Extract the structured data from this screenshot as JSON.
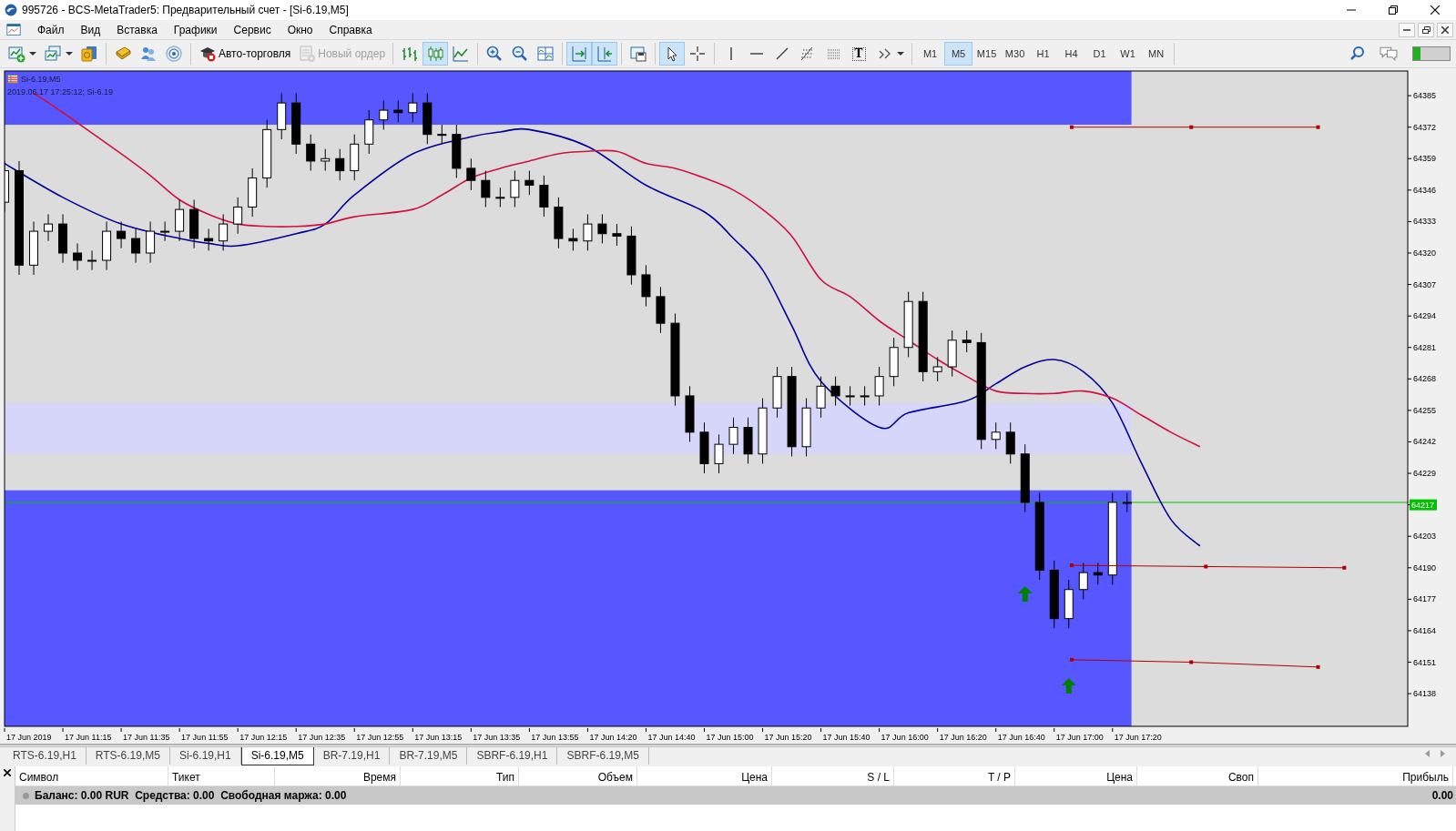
{
  "window": {
    "title": "995726 - BCS-MetaTrader5: Предварительный счет - [Si-6.19,M5]"
  },
  "menu": [
    "Файл",
    "Вид",
    "Вставка",
    "Графики",
    "Сервис",
    "Окно",
    "Справка"
  ],
  "toolbar": {
    "groups": [
      [
        {
          "kind": "icon",
          "selected": false,
          "dropdown": true
        },
        {
          "kind": "icon",
          "selected": false,
          "dropdown": true
        },
        {
          "kind": "icon",
          "selected": false
        }
      ],
      [
        {
          "kind": "icon",
          "selected": false
        },
        {
          "kind": "icon",
          "selected": false
        },
        {
          "kind": "icon",
          "selected": false
        }
      ],
      [
        {
          "kind": "text",
          "label": "Авто-торговля",
          "disabled": false
        },
        {
          "kind": "text",
          "label": "Новый ордер",
          "disabled": true
        }
      ],
      [
        {
          "kind": "icon",
          "selected": false
        },
        {
          "kind": "icon",
          "selected": true
        },
        {
          "kind": "icon",
          "selected": false
        }
      ],
      [
        {
          "kind": "icon",
          "selected": false
        },
        {
          "kind": "icon",
          "selected": false
        },
        {
          "kind": "icon",
          "selected": false
        }
      ],
      [
        {
          "kind": "icon",
          "selected": true
        },
        {
          "kind": "icon",
          "selected": true
        }
      ],
      [
        {
          "kind": "icon",
          "selected": false
        }
      ],
      [
        {
          "kind": "icon",
          "selected": true
        },
        {
          "kind": "icon",
          "selected": false
        }
      ],
      [
        {
          "kind": "icon",
          "selected": false
        },
        {
          "kind": "icon",
          "selected": false
        },
        {
          "kind": "icon",
          "selected": false
        },
        {
          "kind": "icon",
          "selected": false
        },
        {
          "kind": "icon",
          "selected": false
        },
        {
          "kind": "glyph",
          "label": "T",
          "selected": false
        },
        {
          "kind": "icon",
          "selected": false,
          "dropdown": true
        }
      ]
    ],
    "timeframes": [
      {
        "label": "M1",
        "selected": false
      },
      {
        "label": "M5",
        "selected": true
      },
      {
        "label": "M15",
        "selected": false
      },
      {
        "label": "M30",
        "selected": false
      },
      {
        "label": "H1",
        "selected": false
      },
      {
        "label": "H4",
        "selected": false
      },
      {
        "label": "D1",
        "selected": false
      },
      {
        "label": "W1",
        "selected": false
      },
      {
        "label": "MN",
        "selected": false
      }
    ],
    "status_meter": {
      "level": 0.2
    }
  },
  "chart": {
    "legend": {
      "symbol": "Si-6.19,M5",
      "info": "2019.06.17 17:25:12; Si-6.19"
    },
    "price_axis": [
      {
        "label": "64385",
        "current": false
      },
      {
        "label": "64372",
        "current": false
      },
      {
        "label": "64359",
        "current": false
      },
      {
        "label": "64346",
        "current": false
      },
      {
        "label": "64333",
        "current": false
      },
      {
        "label": "64320",
        "current": false
      },
      {
        "label": "64307",
        "current": false
      },
      {
        "label": "64294",
        "current": false
      },
      {
        "label": "64281",
        "current": false
      },
      {
        "label": "64268",
        "current": false
      },
      {
        "label": "64255",
        "current": false
      },
      {
        "label": "64242",
        "current": false
      },
      {
        "label": "64229",
        "current": false
      },
      {
        "label": "64217",
        "current": true
      },
      {
        "label": "64203",
        "current": false
      },
      {
        "label": "64190",
        "current": false
      },
      {
        "label": "64177",
        "current": false
      },
      {
        "label": "64164",
        "current": false
      },
      {
        "label": "64151",
        "current": false
      },
      {
        "label": "64138",
        "current": false
      }
    ],
    "time_axis": [
      "17 Jun 2019",
      "17 Jun 11:15",
      "17 Jun 11:35",
      "17 Jun 11:55",
      "17 Jun 12:15",
      "17 Jun 12:35",
      "17 Jun 12:55",
      "17 Jun 13:15",
      "17 Jun 13:35",
      "17 Jun 13:55",
      "17 Jun 14:20",
      "17 Jun 14:40",
      "17 Jun 15:00",
      "17 Jun 15:20",
      "17 Jun 15:40",
      "17 Jun 16:00",
      "17 Jun 16:20",
      "17 Jun 16:40",
      "17 Jun 17:00",
      "17 Jun 17:20"
    ]
  },
  "tabs": [
    {
      "label": "RTS-6.19,H1",
      "selected": false
    },
    {
      "label": "RTS-6.19,M5",
      "selected": false
    },
    {
      "label": "Si-6.19,H1",
      "selected": false
    },
    {
      "label": "Si-6.19,M5",
      "selected": true
    },
    {
      "label": "BR-7.19,H1",
      "selected": false
    },
    {
      "label": "BR-7.19,M5",
      "selected": false
    },
    {
      "label": "SBRF-6.19,H1",
      "selected": false
    },
    {
      "label": "SBRF-6.19,M5",
      "selected": false
    }
  ],
  "terminal": {
    "columns": [
      "Символ",
      "Тикет",
      "Время",
      "Тип",
      "Объем",
      "Цена",
      "S / L",
      "T / P",
      "Цена",
      "Своп",
      "Прибыль"
    ],
    "balance": {
      "text": "Баланс: 0.00 RUR  Средства: 0.00  Свободная маржа: 0.00",
      "profit": "0.00"
    }
  }
}
